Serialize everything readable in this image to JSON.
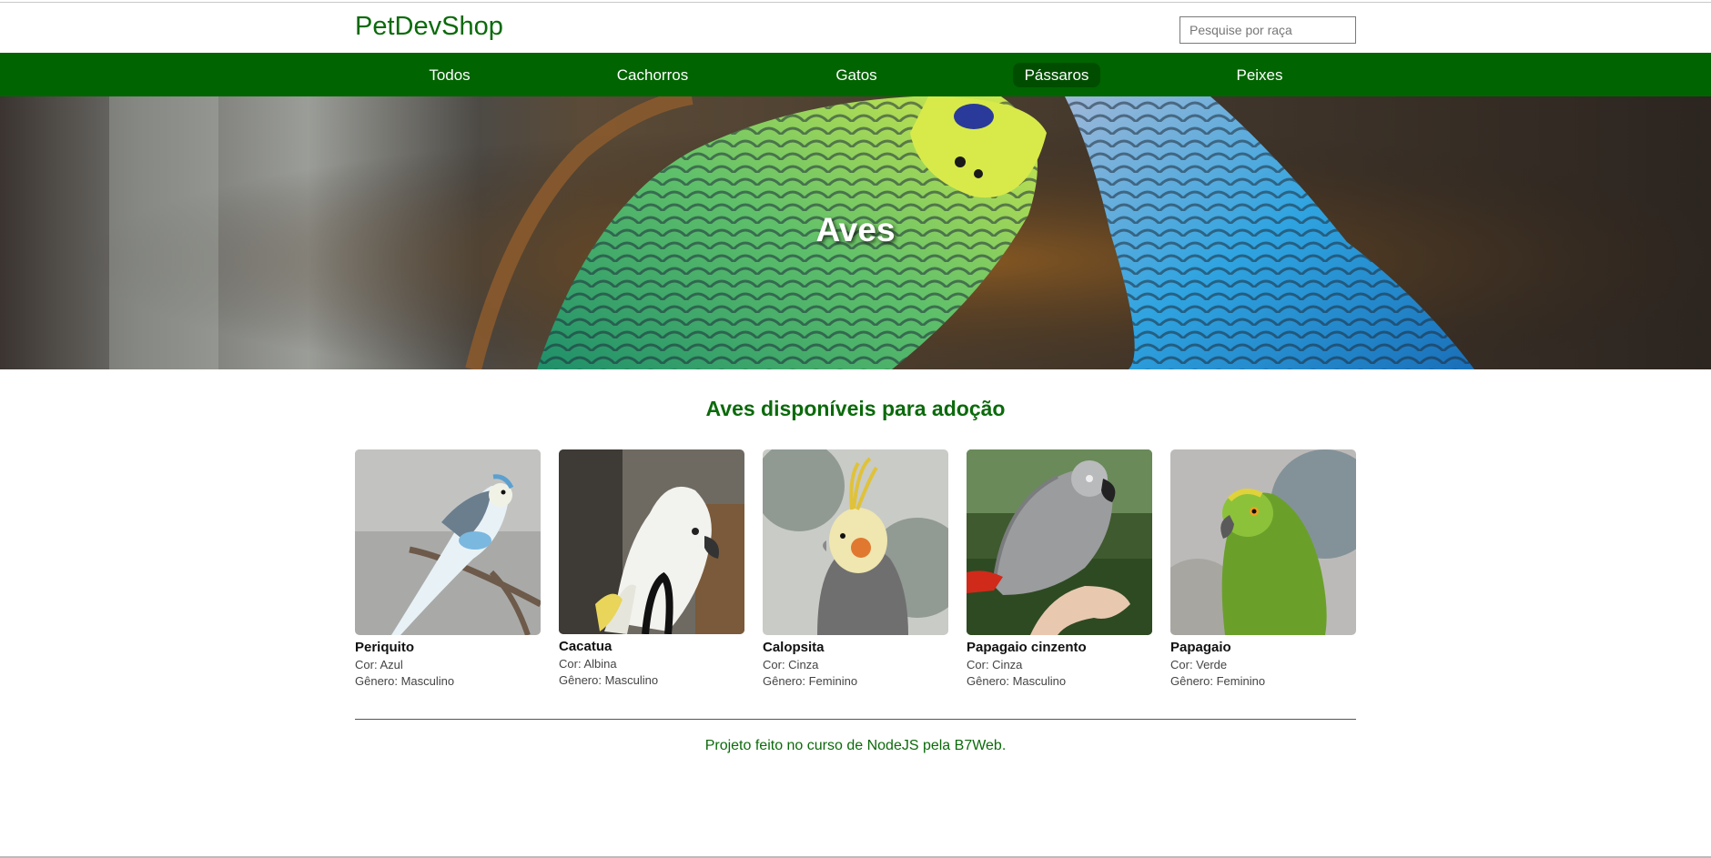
{
  "header": {
    "logo": "PetDevShop",
    "search_placeholder": "Pesquise por raça"
  },
  "nav": {
    "items": [
      {
        "label": "Todos"
      },
      {
        "label": "Cachorros"
      },
      {
        "label": "Gatos"
      },
      {
        "label": "Pássaros",
        "active": true
      },
      {
        "label": "Peixes"
      }
    ]
  },
  "hero": {
    "title": "Aves"
  },
  "main": {
    "section_title": "Aves disponíveis para adoção",
    "cards": [
      {
        "name": "Periquito",
        "cor": "Cor: Azul",
        "genero": "Gênero: Masculino"
      },
      {
        "name": "Cacatua",
        "cor": "Cor: Albina",
        "genero": "Gênero: Masculino"
      },
      {
        "name": "Calopsita",
        "cor": "Cor: Cinza",
        "genero": "Gênero: Feminino"
      },
      {
        "name": "Papagaio cinzento",
        "cor": "Cor: Cinza",
        "genero": "Gênero: Masculino"
      },
      {
        "name": "Papagaio",
        "cor": "Cor: Verde",
        "genero": "Gênero: Feminino"
      }
    ]
  },
  "footer": {
    "text": "Projeto feito no curso de NodeJS pela B7Web."
  },
  "colors": {
    "brand_green": "#0b6a0b",
    "nav_green": "#006400",
    "nav_active": "#004d00"
  }
}
